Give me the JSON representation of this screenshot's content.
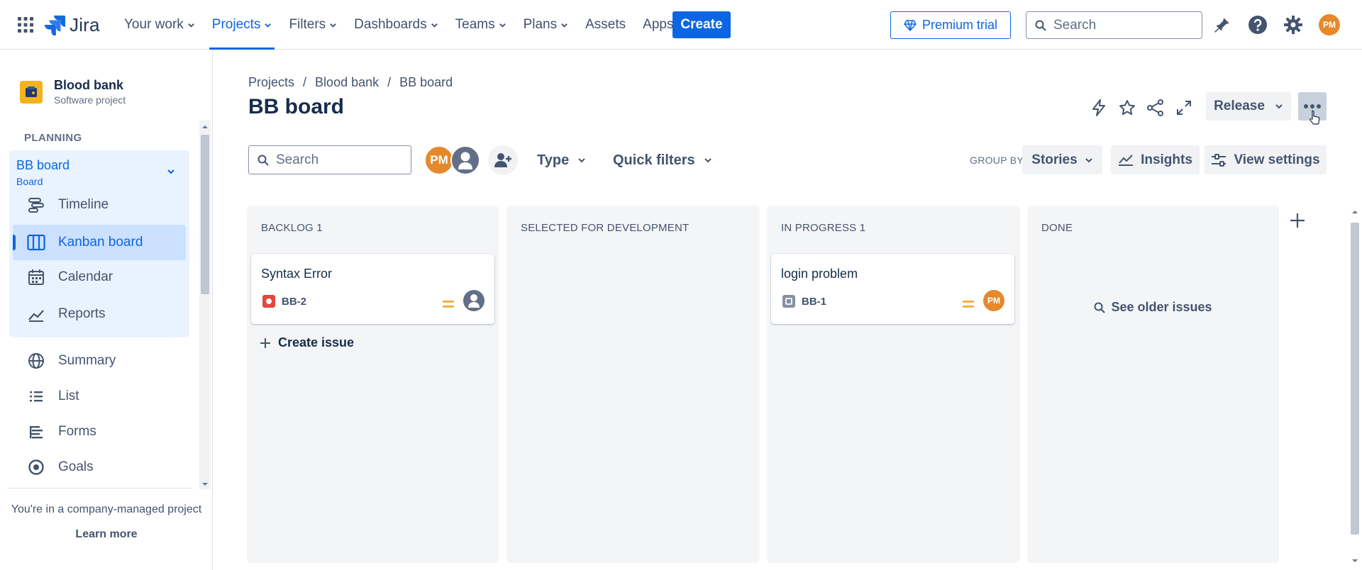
{
  "topnav": {
    "logo_text": "Jira",
    "items": [
      {
        "label": "Your work",
        "has_chevron": true
      },
      {
        "label": "Projects",
        "has_chevron": true,
        "active": true
      },
      {
        "label": "Filters",
        "has_chevron": true
      },
      {
        "label": "Dashboards",
        "has_chevron": true
      },
      {
        "label": "Teams",
        "has_chevron": true
      },
      {
        "label": "Plans",
        "has_chevron": true
      },
      {
        "label": "Assets",
        "has_chevron": false
      },
      {
        "label": "Apps",
        "has_chevron": true
      }
    ],
    "create_label": "Create",
    "premium_label": "Premium trial",
    "search_placeholder": "Search",
    "user_initials": "PM"
  },
  "sidebar": {
    "project_name": "Blood bank",
    "project_type": "Software project",
    "section_label": "PLANNING",
    "board_name": "BB board",
    "board_sub": "Board",
    "items": [
      {
        "label": "Timeline",
        "icon": "timeline-icon"
      },
      {
        "label": "Kanban board",
        "icon": "kanban-board-icon",
        "selected": true
      },
      {
        "label": "Calendar",
        "icon": "calendar-icon"
      },
      {
        "label": "Reports",
        "icon": "reports-icon"
      },
      {
        "label": "Summary",
        "icon": "globe-icon"
      },
      {
        "label": "List",
        "icon": "list-icon"
      },
      {
        "label": "Forms",
        "icon": "forms-icon"
      },
      {
        "label": "Goals",
        "icon": "goals-icon"
      }
    ],
    "note": "You're in a company-managed project",
    "learn_more": "Learn more"
  },
  "header": {
    "breadcrumbs": [
      "Projects",
      "Blood bank",
      "BB board"
    ],
    "title": "BB board",
    "release_label": "Release"
  },
  "toolbar": {
    "search_placeholder": "Search",
    "avatar_initials": "PM",
    "type_label": "Type",
    "quick_filters_label": "Quick filters",
    "group_by_label": "GROUP BY",
    "group_by_value": "Stories",
    "insights_label": "Insights",
    "view_settings_label": "View settings"
  },
  "columns": [
    {
      "title": "BACKLOG 1",
      "cards": [
        {
          "title": "Syntax Error",
          "key": "BB-2",
          "type": "bug",
          "assignee": "unassigned"
        }
      ],
      "create_issue": "Create issue"
    },
    {
      "title": "SELECTED FOR DEVELOPMENT",
      "cards": []
    },
    {
      "title": "IN PROGRESS 1",
      "cards": [
        {
          "title": "login problem",
          "key": "BB-1",
          "type": "task",
          "assignee": "PM"
        }
      ]
    },
    {
      "title": "DONE",
      "cards": [],
      "see_older": "See older issues"
    }
  ],
  "colors": {
    "accent": "#0c66e4",
    "avatar_orange": "#e5892a",
    "bug_red": "#e2483d",
    "priority_medium": "#f5a623"
  }
}
